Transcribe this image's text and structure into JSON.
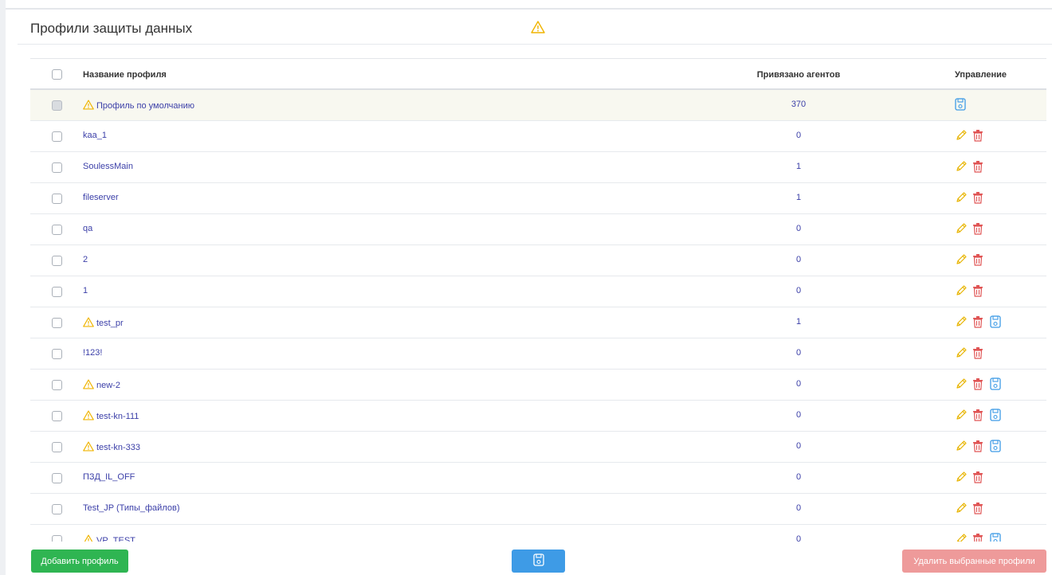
{
  "page": {
    "title": "Профили защиты данных"
  },
  "table": {
    "headers": {
      "name": "Название профиля",
      "agents": "Привязано агентов",
      "control": "Управление"
    },
    "rows": [
      {
        "name": "Профиль по умолчанию",
        "agents": "370",
        "warn": true,
        "default": true,
        "icons": [
          "save"
        ]
      },
      {
        "name": "kaa_1",
        "agents": "0",
        "warn": false,
        "icons": [
          "edit",
          "delete"
        ]
      },
      {
        "name": "SoulessMain",
        "agents": "1",
        "warn": false,
        "icons": [
          "edit",
          "delete"
        ]
      },
      {
        "name": "fileserver",
        "agents": "1",
        "warn": false,
        "icons": [
          "edit",
          "delete"
        ]
      },
      {
        "name": "qa",
        "agents": "0",
        "warn": false,
        "icons": [
          "edit",
          "delete"
        ]
      },
      {
        "name": "2",
        "agents": "0",
        "warn": false,
        "icons": [
          "edit",
          "delete"
        ]
      },
      {
        "name": "1",
        "agents": "0",
        "warn": false,
        "icons": [
          "edit",
          "delete"
        ]
      },
      {
        "name": "test_pr",
        "agents": "1",
        "warn": true,
        "icons": [
          "edit",
          "delete",
          "save"
        ]
      },
      {
        "name": "!123!",
        "agents": "0",
        "warn": false,
        "icons": [
          "edit",
          "delete"
        ]
      },
      {
        "name": "new-2",
        "agents": "0",
        "warn": true,
        "icons": [
          "edit",
          "delete",
          "save"
        ]
      },
      {
        "name": "test-kn-111",
        "agents": "0",
        "warn": true,
        "icons": [
          "edit",
          "delete",
          "save"
        ]
      },
      {
        "name": "test-kn-333",
        "agents": "0",
        "warn": true,
        "icons": [
          "edit",
          "delete",
          "save"
        ]
      },
      {
        "name": "ПЗД_IL_OFF",
        "agents": "0",
        "warn": false,
        "icons": [
          "edit",
          "delete"
        ]
      },
      {
        "name": "Test_JP (Типы_файлов)",
        "agents": "0",
        "warn": false,
        "icons": [
          "edit",
          "delete"
        ]
      },
      {
        "name": "VP_TEST",
        "agents": "0",
        "warn": true,
        "icons": [
          "edit",
          "delete",
          "save"
        ]
      }
    ]
  },
  "footer": {
    "add_label": "Добавить профиль",
    "delete_label": "Удалить выбранные профили"
  },
  "colors": {
    "link": "#3b3fa8",
    "warn": "#f0b400",
    "edit": "#e8b400",
    "delete": "#e05555",
    "save": "#3e9be6",
    "add_button": "#2fb552",
    "delete_button": "#ee9a9a"
  }
}
